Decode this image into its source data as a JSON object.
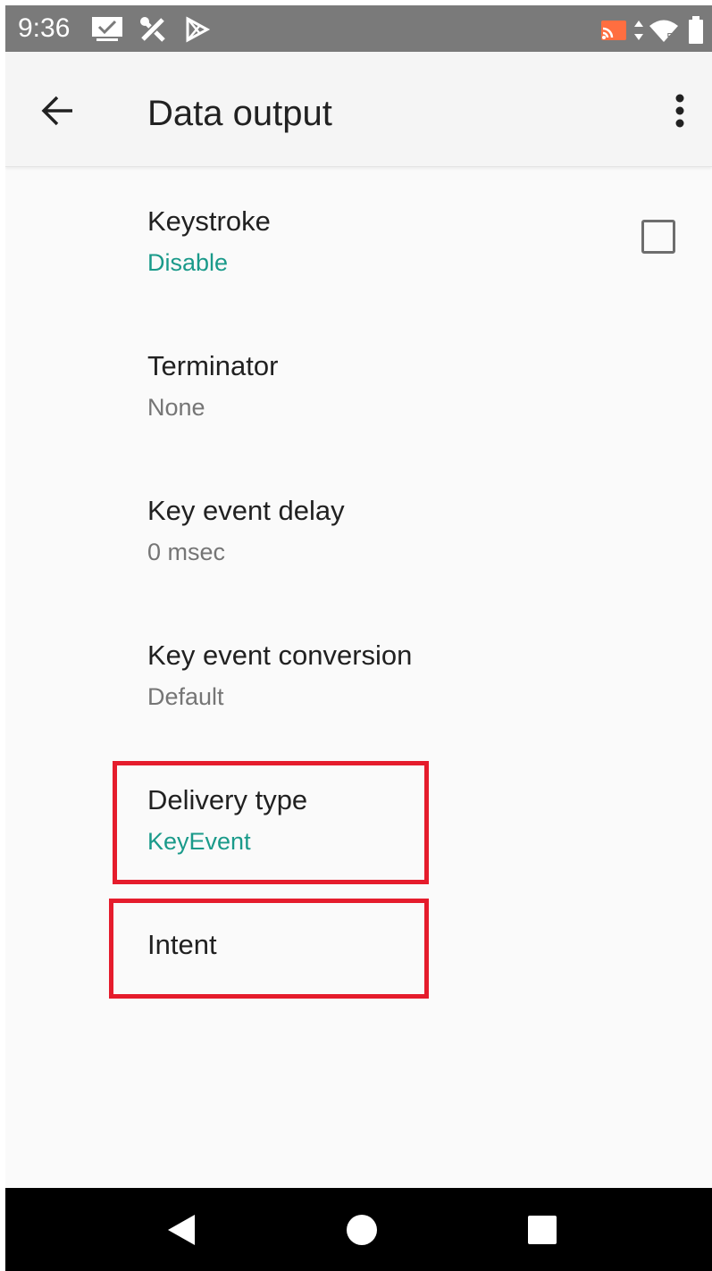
{
  "status_bar": {
    "time": "9:36",
    "left_icons": [
      "screen-icon",
      "tools-icon",
      "play-store-icon"
    ],
    "right_icons": [
      "cast-icon",
      "data-arrows-icon",
      "wifi-icon",
      "battery-icon"
    ],
    "cast_color": "#ff6e40"
  },
  "app_bar": {
    "title": "Data output",
    "back_icon": "arrow-back-icon",
    "menu_icon": "more-vert-icon"
  },
  "preferences": [
    {
      "title": "Keystroke",
      "summary": "Disable",
      "summary_color": "#1a9a8a",
      "checkbox": {
        "checked": false
      }
    },
    {
      "title": "Terminator",
      "summary": "None"
    },
    {
      "title": "Key event delay",
      "summary": "0 msec"
    },
    {
      "title": "Key event conversion",
      "summary": "Default"
    },
    {
      "title": "Delivery type",
      "summary": "KeyEvent",
      "summary_color": "#1a9a8a",
      "highlighted": true
    },
    {
      "title": "Intent",
      "highlighted": true
    }
  ],
  "highlight_color": "#e51c2c",
  "nav_bar": {
    "buttons": [
      "back-triangle-icon",
      "home-circle-icon",
      "recents-square-icon"
    ]
  }
}
